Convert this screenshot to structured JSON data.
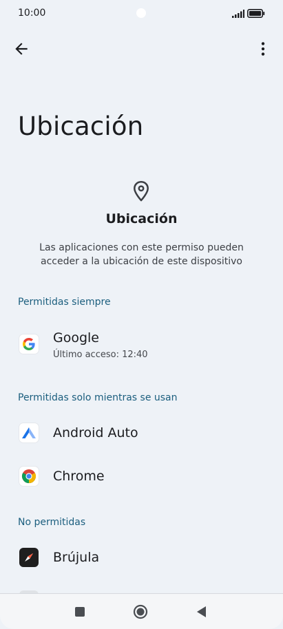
{
  "status_bar": {
    "time": "10:00"
  },
  "header": {
    "title": "Ubicación"
  },
  "intro": {
    "title": "Ubicación",
    "description": "Las aplicaciones con este permiso pueden acceder a la ubicación de este dispositivo"
  },
  "sections": {
    "always": {
      "label": "Permitidas siempre",
      "apps": [
        {
          "name": "Google",
          "subtitle": "Último acceso: 12:40",
          "icon": "google-icon"
        }
      ]
    },
    "while_using": {
      "label": "Permitidas solo mientras se usan",
      "apps": [
        {
          "name": "Android Auto",
          "icon": "android-auto-icon"
        },
        {
          "name": "Chrome",
          "icon": "chrome-icon"
        }
      ]
    },
    "denied": {
      "label": "No permitidas",
      "apps": [
        {
          "name": "Brújula",
          "icon": "compass-icon"
        }
      ]
    }
  },
  "colors": {
    "background": "#eef2f7",
    "section_heading": "#1b5e7e",
    "text_primary": "#1b1c1f"
  }
}
